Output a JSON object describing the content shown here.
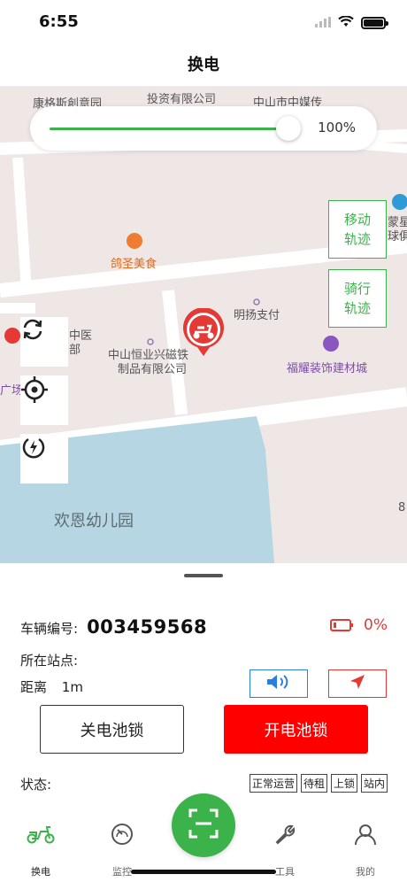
{
  "status_bar": {
    "time": "6:55"
  },
  "nav": {
    "title": "换电"
  },
  "map": {
    "slider_value": "100%",
    "slider_level": 1.0,
    "labels": {
      "kanggesi": "康格斯創意园",
      "touzi": "投资有限公司",
      "zhongmei": "中山市中媒传",
      "gesheng": "鸽圣美食",
      "mingyang": "明扬支付",
      "hengye_1": "中山恒业兴磁铁",
      "hengye_2": "制品有限公司",
      "fuyao": "福耀装饰建材城",
      "meng": "蒙星",
      "qiu": "球俱",
      "zhongyi_1": "中医",
      "zhongyi_2": "部",
      "guang": "广场",
      "kindergarten": "欢恩幼儿园",
      "edge_8": "8"
    },
    "track_move": {
      "line1": "移动",
      "line2": "轨迹"
    },
    "track_ride": {
      "line1": "骑行",
      "line2": "轨迹"
    },
    "icons": {
      "refresh": "refresh-icon",
      "locate": "crosshair-icon",
      "power": "power-bolt-icon",
      "marker": "scooter-marker-icon"
    }
  },
  "vehicle": {
    "number_label": "车辆编号:",
    "number": "003459568",
    "battery_pct": "0%",
    "station_label": "所在站点:",
    "distance_label": "距离",
    "distance_value": "1m",
    "status_label": "状态:",
    "tags": [
      "正常运营",
      "待租",
      "上锁",
      "站内"
    ]
  },
  "actions": {
    "close_lock": "关电池锁",
    "open_lock": "开电池锁"
  },
  "tabs": [
    {
      "label": "换电",
      "icon": "scooter-icon"
    },
    {
      "label": "监控",
      "icon": "gauge-icon"
    },
    {
      "label": "工具",
      "icon": "wrench-icon"
    },
    {
      "label": "我的",
      "icon": "user-icon"
    }
  ],
  "colors": {
    "accent": "#3cb24a",
    "danger": "#ff0000",
    "info": "#2a7de1"
  }
}
